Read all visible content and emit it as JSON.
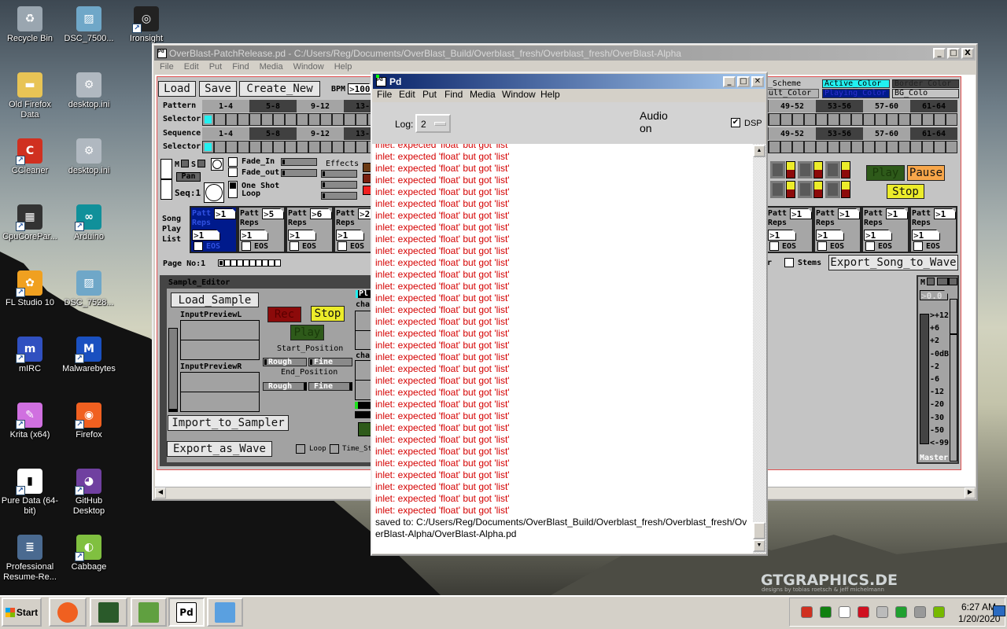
{
  "desktop": {
    "columns": [
      [
        {
          "label": "Recycle Bin",
          "icon": "recycle-bin"
        },
        {
          "label": "Old Firefox Data",
          "icon": "folder"
        },
        {
          "label": "CCleaner",
          "icon": "ccleaner"
        },
        {
          "label": "CpuCorePar...",
          "icon": "cpu-chip"
        },
        {
          "label": "FL Studio 10",
          "icon": "fl-studio"
        },
        {
          "label": "mIRC",
          "icon": "mirc"
        },
        {
          "label": "Krita (x64)",
          "icon": "krita"
        },
        {
          "label": "Pure Data (64-bit)",
          "icon": "pure-data"
        },
        {
          "label": "Professional Resume-Re...",
          "icon": "document"
        }
      ],
      [
        {
          "label": "DSC_7500...",
          "icon": "image"
        },
        {
          "label": "desktop.ini",
          "icon": "settings-file"
        },
        {
          "label": "desktop.ini",
          "icon": "settings-file"
        },
        {
          "label": "Arduino",
          "icon": "arduino"
        },
        {
          "label": "DSC_7528...",
          "icon": "image"
        },
        {
          "label": "Malwarebytes",
          "icon": "malwarebytes"
        },
        {
          "label": "Firefox",
          "icon": "firefox"
        },
        {
          "label": "GitHub Desktop",
          "icon": "github"
        },
        {
          "label": "Cabbage",
          "icon": "cabbage"
        }
      ],
      [
        {
          "label": "Ironsight",
          "icon": "ironsight"
        }
      ]
    ],
    "watermark": {
      "title": "GTGRAPHICS.DE",
      "subtitle": "designs by tobias roetsch & jeff michelmann"
    }
  },
  "main_window": {
    "title": "OverBlast-PatchRelease.pd  - C:/Users/Reg/Documents/OverBlast_Build/Overblast_fresh/Overblast_fresh/OverBlast-Alpha",
    "menu": [
      "File",
      "Edit",
      "Put",
      "Find",
      "Media",
      "Window",
      "Help"
    ],
    "patch": {
      "load": "Load",
      "save": "Save",
      "create_new": "Create_New",
      "bpm_label": "BPM",
      "bpm": "100",
      "pattern_label": "Pattern",
      "selector_label": "Selector",
      "sequence_label": "Sequence",
      "groups": [
        "1-4",
        "5-8",
        "9-12",
        "13-16",
        "",
        "",
        "",
        "",
        "",
        "",
        "",
        "",
        "49-52",
        "53-56",
        "57-60",
        "61-64"
      ],
      "pattern_selected": 0,
      "sequence_selected": 0,
      "scheme": {
        "scheme": "r_Scheme",
        "default": "ault_Color",
        "active": "Active_Color",
        "playing": "Playing_Color",
        "border": "Border_Color",
        "bg": "BG_Colo"
      },
      "colors": {
        "active": "#22f0f0",
        "playing": "#001a8c",
        "border": "#404040",
        "play": "#2e5a1a",
        "pause": "#f7a64a",
        "stop": "#ecec2a",
        "rec": "#8c0a0a"
      },
      "track": {
        "m": "M",
        "s": "S",
        "pan": "Pan",
        "seq": "Seq:1",
        "fade_in": "Fade_In",
        "fade_out": "Fade_out",
        "one_shot": "One Shot",
        "loop": "Loop",
        "effects": "Effects"
      },
      "transport": {
        "play": "Play",
        "pause": "Pause",
        "stop": "Stop"
      },
      "song_label": [
        "Song",
        "Play",
        "List"
      ],
      "cell_labels": {
        "patt": "Patt",
        "reps": "Reps",
        "eos": "EOS"
      },
      "playlist": [
        {
          "patt": "1",
          "reps": "1",
          "active": true
        },
        {
          "patt": "5",
          "reps": "1"
        },
        {
          "patt": "6",
          "reps": "1"
        },
        {
          "patt": "2",
          "reps": "1"
        },
        {},
        {},
        {},
        {},
        {},
        {},
        {},
        {},
        {
          "patt": "1",
          "reps": "1"
        },
        {
          "patt": "1",
          "reps": "1"
        },
        {
          "patt": "1",
          "reps": "1"
        },
        {
          "patt": "1",
          "reps": "1"
        }
      ],
      "page_label": "Page No:1",
      "page_count": 10,
      "page_current": 1,
      "r_cut": "r",
      "stems": "Stems",
      "export_song": "Export_Song_to_Wave",
      "sample_editor": {
        "title": "Sample_Editor",
        "load_sample": "Load_Sample",
        "input_l": "InputPreviewL",
        "input_r": "InputPreviewR",
        "import": "Import_to_Sampler",
        "export": "Export_as_Wave",
        "rec": "Rec",
        "stop": "Stop",
        "play": "Play",
        "start_pos": "Start_Position",
        "end_pos": "End_Position",
        "rough": "Rough",
        "fine": "Fine",
        "loop": "Loop",
        "time_stretch": "Time_St",
        "pl": "Pl",
        "cha": "cha"
      },
      "master": {
        "m": "M",
        "value": "0.0",
        "scale": [
          ">+12",
          "+6",
          "+2",
          "-0dB",
          "-2",
          "-6",
          "-12",
          "-20",
          "-30",
          "-50",
          "<-99"
        ],
        "label": "Master",
        "fader_level": 0.79
      }
    }
  },
  "pd_window": {
    "title": "Pd",
    "menu": [
      "File",
      "Edit",
      "Put",
      "Find",
      "Media",
      "Window",
      "Help"
    ],
    "log_label": "Log:",
    "log_value": "2",
    "audio_status": "Audio on",
    "dsp_label": "DSP",
    "dsp_checked": true,
    "errors": [
      "inlet: expected 'float' but got 'list'",
      "inlet: expected 'float' but got 'list'",
      "inlet: expected 'float' but got 'list'",
      "inlet: expected 'float' but got 'list'",
      "inlet: expected 'float' but got 'list'",
      "inlet: expected 'float' but got 'list'",
      "inlet: expected 'float' but got 'list'",
      "inlet: expected 'float' but got 'list'",
      "inlet: expected 'float' but got 'list'",
      "inlet: expected 'float' but got 'list'",
      "inlet: expected 'float' but got 'list'",
      "inlet: expected 'float' but got 'list'",
      "inlet: expected 'float' but got 'list'",
      "inlet: expected 'float' but got 'list'",
      "inlet: expected 'float' but got 'list'",
      "inlet: expected 'float' but got 'list'",
      "inlet: expected 'float' but got 'list'",
      "inlet: expected 'float' but got 'list'",
      "inlet: expected 'float' but got 'list'",
      "inlet: expected 'float' but got 'list'",
      "inlet: expected 'float' but got 'list'",
      "inlet: expected 'float' but got 'list'",
      "inlet: expected 'float' but got 'list'",
      "inlet: expected 'float' but got 'list'",
      "inlet: expected 'float' but got 'list'",
      "inlet: expected 'float' but got 'list'",
      "inlet: expected 'float' but got 'list'",
      "inlet: expected 'float' but got 'list'",
      "inlet: expected 'float' but got 'list'",
      "inlet: expected 'float' but got 'list'",
      "inlet: expected 'float' but got 'list'",
      "inlet: expected 'float' but got 'list'"
    ],
    "saved": "saved to: C:/Users/Reg/Documents/OverBlast_Build/Overblast_fresh/Overblast_fresh/OverBlast-Alpha/OverBlast-Alpha.pd"
  },
  "taskbar": {
    "start": "Start",
    "tasks": [
      {
        "icon": "firefox"
      },
      {
        "icon": "resource-monitor"
      },
      {
        "icon": "notepad-plus-plus"
      },
      {
        "icon": "pure-data",
        "label": "Pd",
        "active": true
      },
      {
        "icon": "paint"
      }
    ],
    "tray_icons": [
      "ccleaner",
      "green-grid",
      "action-center-flag",
      "red-arrow-app",
      "volume",
      "network-sync",
      "network",
      "nvidia"
    ],
    "time": "6:27 AM",
    "date": "1/20/2020"
  }
}
